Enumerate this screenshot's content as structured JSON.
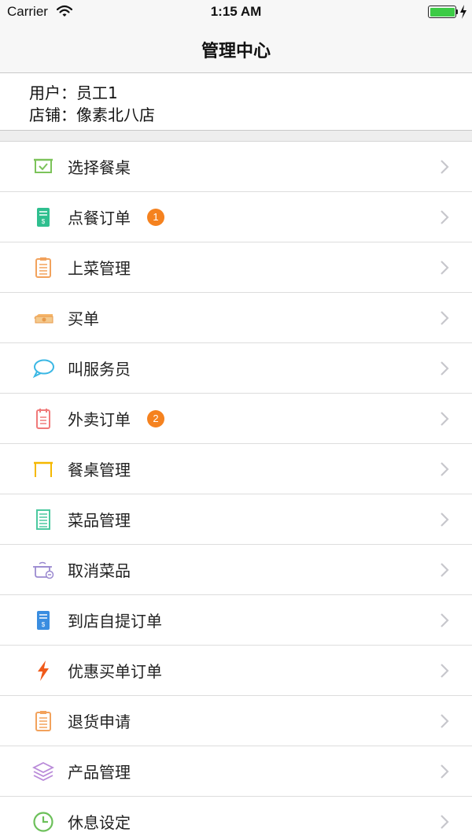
{
  "status_bar": {
    "carrier": "Carrier",
    "time": "1:15 AM",
    "battery_color": "#3ccb45"
  },
  "nav": {
    "title": "管理中心"
  },
  "user_info": {
    "user_line": "用户：员工1",
    "store_line": "店铺：像素北八店"
  },
  "menu": {
    "items": [
      {
        "label": "选择餐桌",
        "icon": "table-select-icon",
        "badge": ""
      },
      {
        "label": "点餐订单",
        "icon": "order-receipt-icon",
        "badge": "1"
      },
      {
        "label": "上菜管理",
        "icon": "clipboard-icon",
        "badge": ""
      },
      {
        "label": "买单",
        "icon": "cash-icon",
        "badge": ""
      },
      {
        "label": "叫服务员",
        "icon": "chat-bubble-icon",
        "badge": ""
      },
      {
        "label": "外卖订单",
        "icon": "notepad-icon",
        "badge": "2"
      },
      {
        "label": "餐桌管理",
        "icon": "table-icon",
        "badge": ""
      },
      {
        "label": "菜品管理",
        "icon": "document-list-icon",
        "badge": ""
      },
      {
        "label": "取消菜品",
        "icon": "pot-cancel-icon",
        "badge": ""
      },
      {
        "label": "到店自提订单",
        "icon": "pickup-receipt-icon",
        "badge": ""
      },
      {
        "label": "优惠买单订单",
        "icon": "lightning-icon",
        "badge": ""
      },
      {
        "label": "退货申请",
        "icon": "clipboard-return-icon",
        "badge": ""
      },
      {
        "label": "产品管理",
        "icon": "layers-icon",
        "badge": ""
      },
      {
        "label": "休息设定",
        "icon": "clock-icon",
        "badge": ""
      }
    ]
  },
  "colors": {
    "badge": "#f5821f",
    "chevron": "#c7c7cc"
  }
}
